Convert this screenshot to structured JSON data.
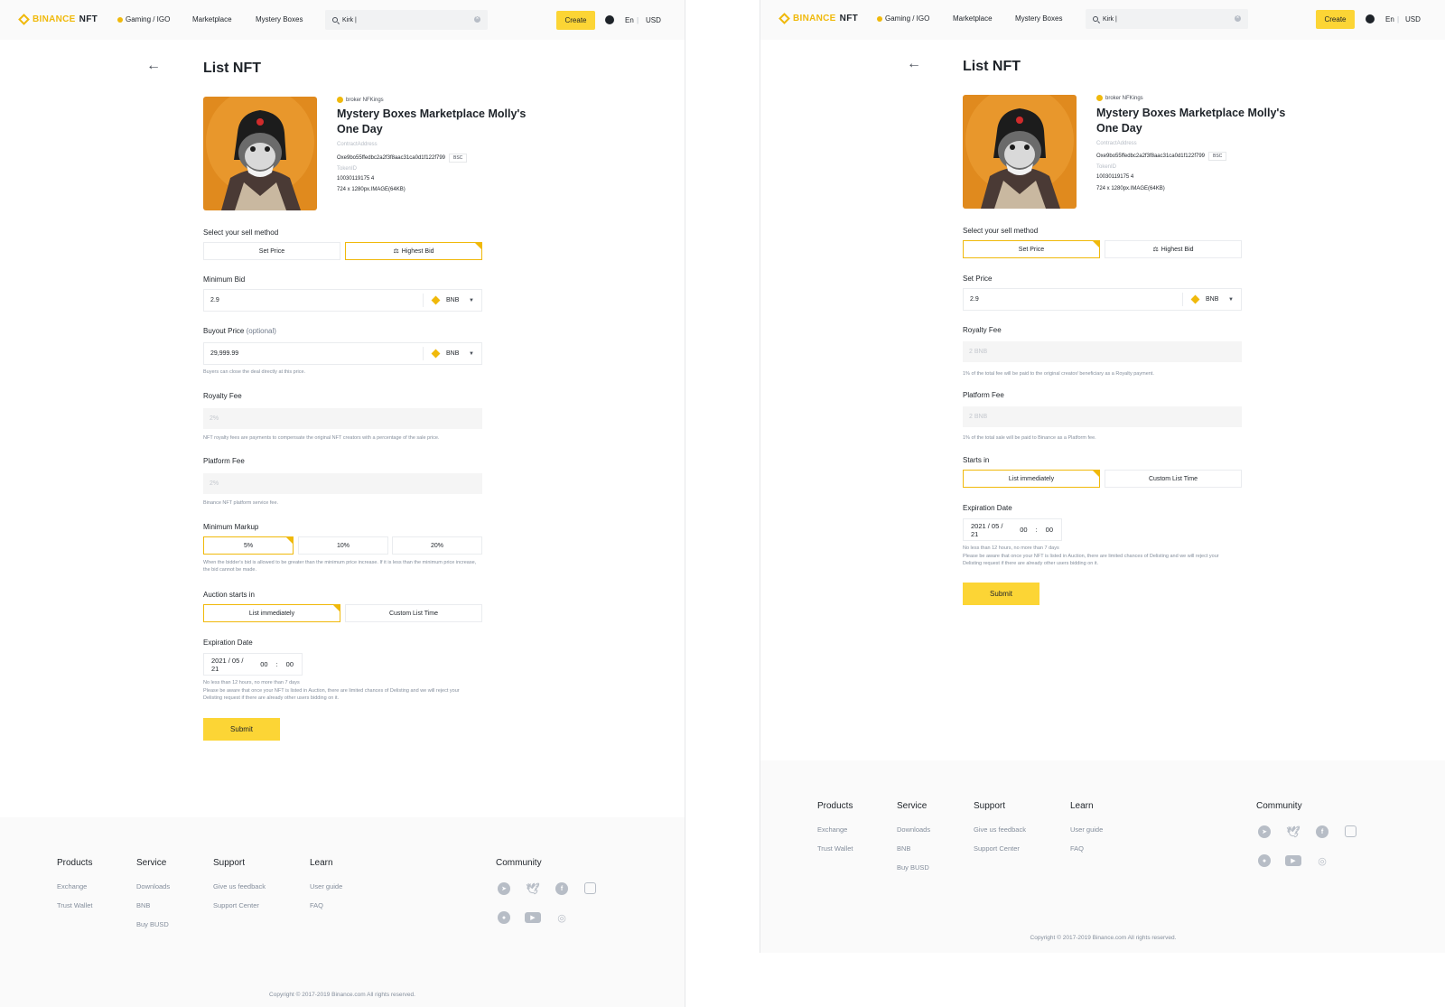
{
  "header": {
    "logo_brand": "BINANCE",
    "logo_suffix": "NFT",
    "nav": [
      "Gaming / IGO",
      "Marketplace",
      "Mystery Boxes"
    ],
    "search_value": "Kirk |",
    "create_label": "Create",
    "lang": "En",
    "currency": "USD"
  },
  "page": {
    "title": "List NFT",
    "nft": {
      "creator": "broker NFKings",
      "title": "Mystery Boxes Marketplace Molly's One Day",
      "contract_label": "ContractAddress",
      "contract_value": "Oxe9bo55ffedbc2a2f3f8aac31ca0d1f122f799",
      "chain": "BSC",
      "token_label": "TokenID",
      "token_value": "10030119175 4",
      "size": "724 x 1280px.IMAGE(64KB)"
    },
    "sell_method_label": "Select your sell method",
    "sell_methods": [
      "Set Price",
      "Highest Bid"
    ]
  },
  "auction": {
    "min_bid_label": "Minimum Bid",
    "min_bid_value": "2.9",
    "currency": "BNB",
    "buyout_label": "Buyout Price",
    "buyout_optional": "(optional)",
    "buyout_value": "29,999.99",
    "buyout_helper": "Buyers can close the deal directly at this price.",
    "royalty_label": "Royalty Fee",
    "royalty_value": "2%",
    "royalty_helper": "NFT royalty fees are payments to compensate the original NFT creators with a percentage of the sale price.",
    "platform_label": "Platform Fee",
    "platform_value": "2%",
    "platform_helper": "Binance NFT platform service fee.",
    "markup_label": "Minimum Markup",
    "markups": [
      "5%",
      "10%",
      "20%"
    ],
    "markup_helper": "When the bidder's bid is allowed to be greater than the minimum price increase. If it is less than the minimum price increase, the bid cannot be made.",
    "starts_label": "Auction starts in",
    "starts_options": [
      "List immediately",
      "Custom List Time"
    ],
    "expiration_label": "Expiration Date",
    "date": [
      "2021 / 05 / 21",
      "00",
      ":",
      "00"
    ],
    "expiration_helper": "No less than 12 hours, no more than 7 days",
    "delisting_helper": "Please be aware that once your NFT is listed in Auction, there are limited chances of Delisting and we will reject your Delisting request if there are already other users bidding on it.",
    "submit_label": "Submit"
  },
  "fixed": {
    "price_label": "Set Price",
    "price_value": "2.9",
    "currency": "BNB",
    "royalty_label": "Royalty Fee",
    "royalty_value": "2 BNB",
    "royalty_helper": "1% of the total fee will be paid to the original creator/ beneficiary as a Royalty payment.",
    "platform_label": "Platform Fee",
    "platform_value": "2 BNB",
    "platform_helper": "1% of the total sale will be paid to Binance as a Platform fee.",
    "starts_label": "Starts in",
    "starts_options": [
      "List immediately",
      "Custom List Time"
    ],
    "expiration_label": "Expiration Date",
    "date": [
      "2021 / 05 / 21",
      "00",
      ":",
      "00"
    ],
    "expiration_helper": "No less than 12 hours, no more than 7 days",
    "delisting_helper": "Please be aware that once your NFT is listed in Auction, there are limited chances of Delisting and we will reject your Delisting request if there are already other users bidding on it.",
    "submit_label": "Submit"
  },
  "footer": {
    "columns": [
      {
        "title": "Products",
        "links": [
          "Exchange",
          "Trust Wallet"
        ]
      },
      {
        "title": "Service",
        "links": [
          "Downloads",
          "BNB",
          "Buy BUSD"
        ]
      },
      {
        "title": "Support",
        "links": [
          "Give us feedback",
          "Support Center"
        ]
      },
      {
        "title": "Learn",
        "links": [
          "User guide",
          "FAQ"
        ]
      }
    ],
    "community_title": "Community",
    "social_icons": [
      "telegram-icon",
      "twitter-icon",
      "facebook-icon",
      "instagram-icon",
      "reddit-icon",
      "youtube-icon",
      "weibo-icon"
    ],
    "copyright": "Copyright © 2017-2019 Binance.com All rights reserved."
  },
  "colors": {
    "accent": "#fcd535",
    "brand": "#f0b90b",
    "text": "#1e2329",
    "muted": "#848e9c"
  }
}
